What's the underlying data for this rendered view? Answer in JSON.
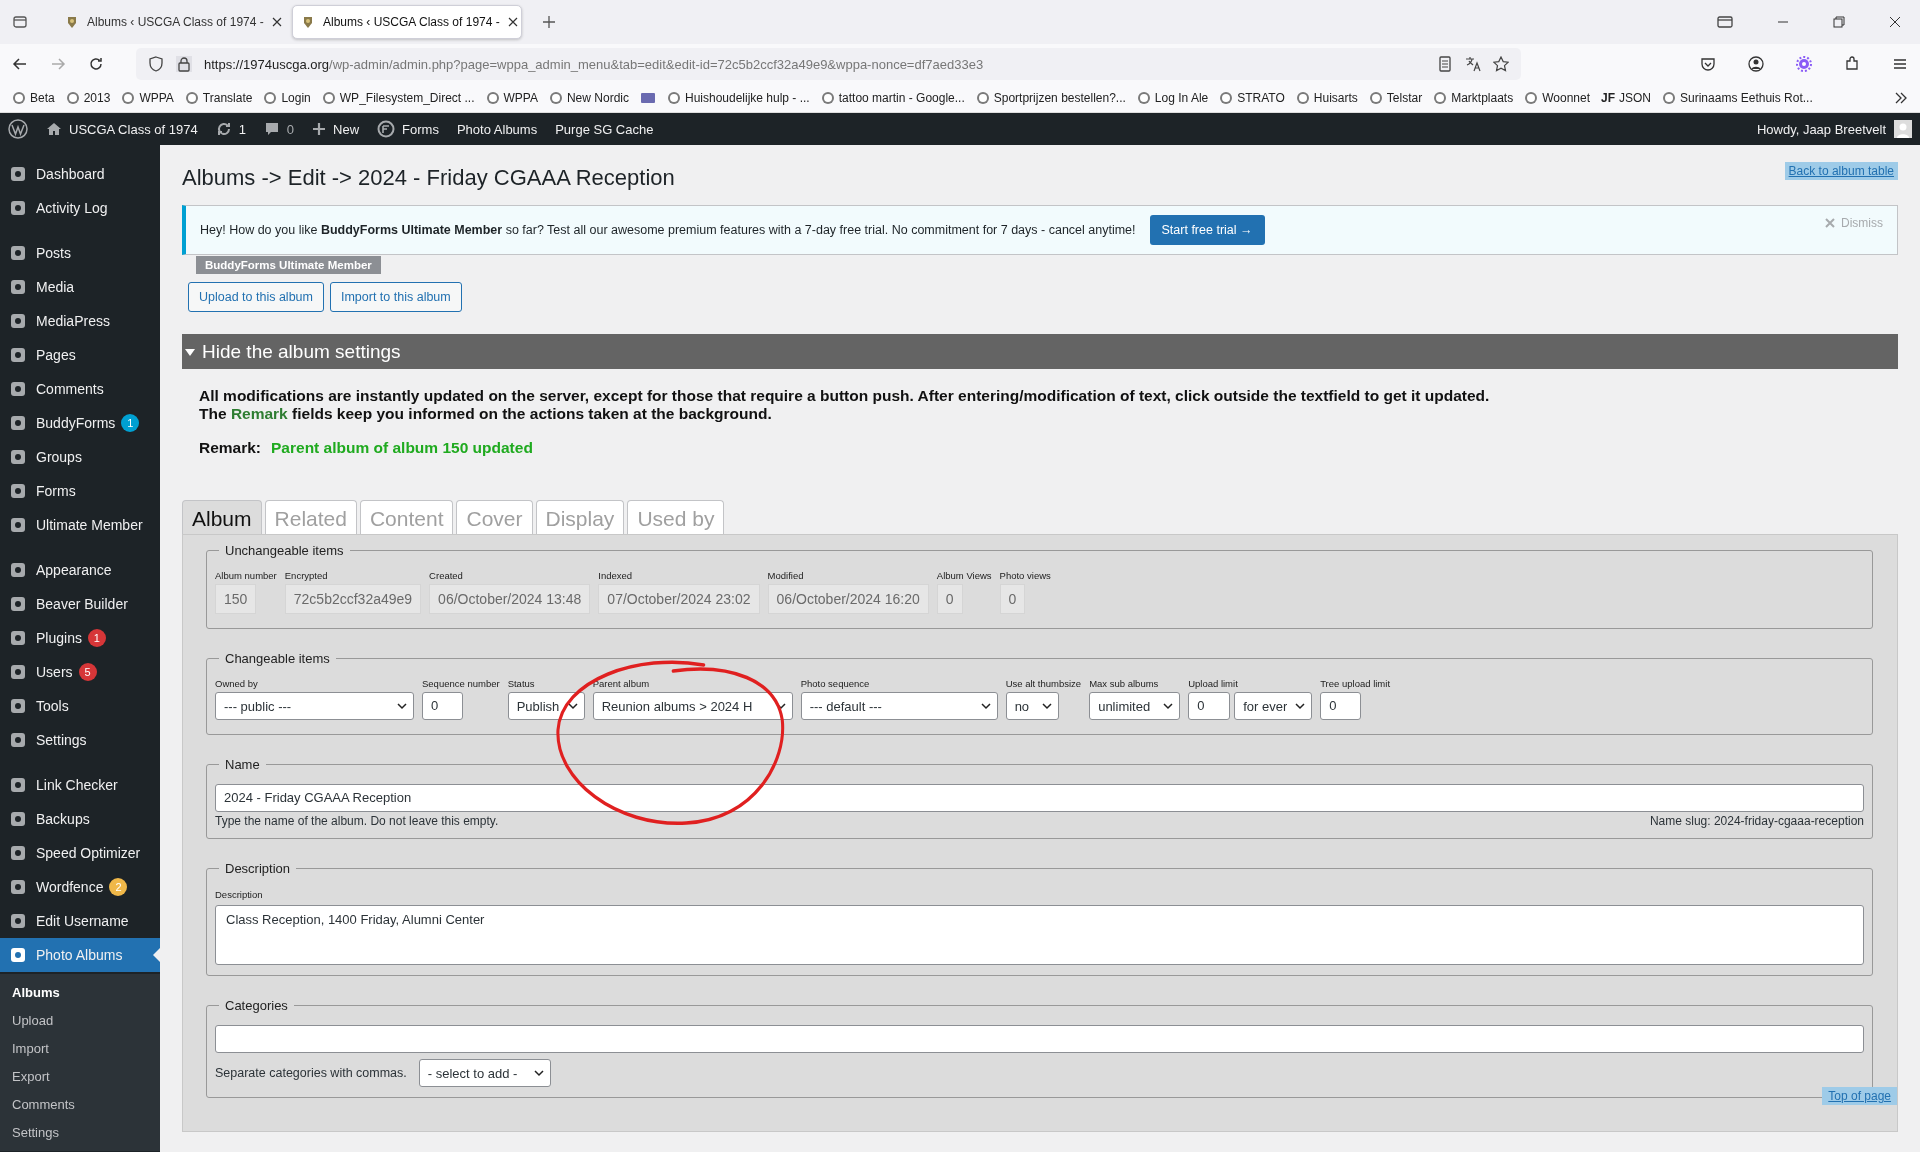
{
  "browser": {
    "tabs": [
      {
        "title": "Albums ‹ USCGA Class of 1974 -",
        "selected": false
      },
      {
        "title": "Albums ‹ USCGA Class of 1974 -",
        "selected": true
      }
    ],
    "url": {
      "host": "https://1974uscga.org",
      "path": "/wp-admin/admin.php?page=wppa_admin_menu&tab=edit&edit-id=72c5b2ccf32a49e9&wppa-nonce=df7aed33e3"
    },
    "bookmarks": [
      {
        "kind": "link",
        "label": "Beta"
      },
      {
        "kind": "link",
        "label": "2013"
      },
      {
        "kind": "link",
        "label": "WPPA"
      },
      {
        "kind": "link",
        "label": "Translate"
      },
      {
        "kind": "link",
        "label": "Login"
      },
      {
        "kind": "link",
        "label": "WP_Filesystem_Direct ..."
      },
      {
        "kind": "link",
        "label": "WPPA"
      },
      {
        "kind": "link",
        "label": "New Nordic"
      },
      {
        "kind": "icon"
      },
      {
        "kind": "link",
        "label": "Huishoudelijke hulp - ..."
      },
      {
        "kind": "link",
        "label": "tattoo martin - Google..."
      },
      {
        "kind": "link",
        "label": "Sportprijzen bestellen?..."
      },
      {
        "kind": "link",
        "label": "Log In Ale"
      },
      {
        "kind": "link",
        "label": "STRATO"
      },
      {
        "kind": "link",
        "label": "Huisarts"
      },
      {
        "kind": "link",
        "label": "Telstar"
      },
      {
        "kind": "link",
        "label": "Marktplaats"
      },
      {
        "kind": "link",
        "label": "Woonnet"
      },
      {
        "kind": "text-icon",
        "icon_text": "JF",
        "label": "JSON"
      },
      {
        "kind": "link",
        "label": "Surinaams Eethuis Rot..."
      }
    ]
  },
  "admin_bar": {
    "site": "USCGA Class of 1974",
    "updates": "1",
    "comments": "0",
    "new": "New",
    "items": [
      {
        "kind": "icon",
        "label": "Forms"
      },
      {
        "kind": "plain",
        "label": "Photo Albums"
      },
      {
        "kind": "plain",
        "label": "Purge SG Cache"
      }
    ],
    "greeting": "Howdy, Jaap Breetvelt"
  },
  "sidebar": {
    "groups": [
      {
        "items": [
          {
            "label": "Dashboard",
            "selected": false
          },
          {
            "label": "Activity Log",
            "selected": false
          }
        ]
      },
      {
        "items": [
          {
            "label": "Posts",
            "selected": false
          },
          {
            "label": "Media",
            "selected": false
          },
          {
            "label": "MediaPress",
            "selected": false
          },
          {
            "label": "Pages",
            "selected": false
          },
          {
            "label": "Comments",
            "selected": false
          },
          {
            "label": "BuddyForms",
            "selected": false,
            "badge": "1",
            "color": "#00a0d2"
          },
          {
            "label": "Groups",
            "selected": false
          },
          {
            "label": "Forms",
            "selected": false
          },
          {
            "label": "Ultimate Member",
            "selected": false
          }
        ]
      },
      {
        "items": [
          {
            "label": "Appearance",
            "selected": false
          },
          {
            "label": "Beaver Builder",
            "selected": false
          },
          {
            "label": "Plugins",
            "selected": false,
            "badge": "1",
            "color": "#d63638"
          },
          {
            "label": "Users",
            "selected": false,
            "badge": "5",
            "color": "#d63638"
          },
          {
            "label": "Tools",
            "selected": false
          },
          {
            "label": "Settings",
            "selected": false
          }
        ]
      },
      {
        "items": [
          {
            "label": "Link Checker",
            "selected": false
          },
          {
            "label": "Backups",
            "selected": false
          },
          {
            "label": "Speed Optimizer",
            "selected": false
          },
          {
            "label": "Wordfence",
            "selected": false,
            "badge": "2",
            "color": "#f0b849"
          },
          {
            "label": "Edit Username",
            "selected": false
          },
          {
            "label": "Photo Albums",
            "selected": true
          }
        ]
      }
    ],
    "submenu": [
      {
        "label": "Albums",
        "selected": true
      },
      {
        "label": "Upload",
        "selected": false
      },
      {
        "label": "Import",
        "selected": false
      },
      {
        "label": "Export",
        "selected": false
      },
      {
        "label": "Comments",
        "selected": false
      },
      {
        "label": "Settings",
        "selected": false
      }
    ]
  },
  "page": {
    "title": "Albums -> Edit -> 2024 - Friday CGAAA Reception",
    "back_link": "Back to album table",
    "notice": {
      "text": "Hey! How do you like **BuddyForms Ultimate Member** so far? Test all our awesome premium features with a 7-day free trial. No commitment for 7 days - cancel anytime!",
      "button": "Start free trial →",
      "dismiss": "Dismiss"
    },
    "notice_badge": "BuddyForms Ultimate Member",
    "actions": [
      "Upload to this album",
      "Import to this album"
    ],
    "settings_bar": {
      "label": "Hide the album settings",
      "expanded": true
    },
    "info": [
      "All modifications are instantly updated on the server, except for those that require a button push. After entering/modification of text, click outside the textfield to get it updated.",
      "The **Remark** fields keep you informed on the actions taken at the background."
    ],
    "remark": {
      "label": "Remark:",
      "value": "Parent album of album 150 updated"
    },
    "tabs": [
      {
        "label": "Album",
        "selected": true
      },
      {
        "label": "Related",
        "selected": false
      },
      {
        "label": "Content",
        "selected": false
      },
      {
        "label": "Cover",
        "selected": false
      },
      {
        "label": "Display",
        "selected": false
      },
      {
        "label": "Used by",
        "selected": false
      }
    ],
    "unchangeable": {
      "legend": "Unchangeable items",
      "fields": [
        {
          "label": "Album number",
          "value": "150"
        },
        {
          "label": "Encrypted",
          "value": "72c5b2ccf32a49e9"
        },
        {
          "label": "Created",
          "value": "06/October/2024 13:48"
        },
        {
          "label": "Indexed",
          "value": "07/October/2024 23:02"
        },
        {
          "label": "Modified",
          "value": "06/October/2024 16:20"
        },
        {
          "label": "Album Views",
          "value": "0"
        },
        {
          "label": "Photo views",
          "value": "0"
        }
      ]
    },
    "changeable": {
      "legend": "Changeable items",
      "fields": [
        {
          "label": "Owned by",
          "controls": [
            {
              "kind": "select",
              "value": "--- public ---"
            }
          ]
        },
        {
          "label": "Sequence number",
          "controls": [
            {
              "kind": "input",
              "value": "0"
            }
          ]
        },
        {
          "label": "Status",
          "controls": [
            {
              "kind": "select",
              "value": "Publish"
            }
          ]
        },
        {
          "label": "Parent album",
          "controls": [
            {
              "kind": "select",
              "value": "Reunion albums > 2024 H"
            }
          ]
        },
        {
          "label": "Photo sequence",
          "controls": [
            {
              "kind": "select",
              "value": "--- default ---"
            }
          ]
        },
        {
          "label": "Use alt thumbsize",
          "controls": [
            {
              "kind": "select",
              "value": "no"
            }
          ]
        },
        {
          "label": "Max sub albums",
          "controls": [
            {
              "kind": "select",
              "value": "unlimited"
            }
          ]
        },
        {
          "label": "Upload limit",
          "controls": [
            {
              "kind": "input",
              "value": "0"
            },
            {
              "kind": "select",
              "value": "for ever"
            }
          ]
        },
        {
          "label": "Tree upload limit",
          "controls": [
            {
              "kind": "input",
              "value": "0"
            }
          ]
        }
      ]
    },
    "name": {
      "legend": "Name",
      "value": "2024 - Friday CGAAA Reception",
      "hint": "Type the name of the album. Do not leave this empty.",
      "slug": "Name slug: 2024-friday-cgaaa-reception"
    },
    "description": {
      "legend": "Description",
      "label": "Description",
      "value": "Class Reception, 1400 Friday, Alumni Center"
    },
    "categories": {
      "legend": "Categories",
      "hint": "Separate categories with commas.",
      "select": "- select to add -"
    },
    "top_link": "Top of page",
    "annotations": [
      {
        "kind": "circle"
      }
    ]
  }
}
